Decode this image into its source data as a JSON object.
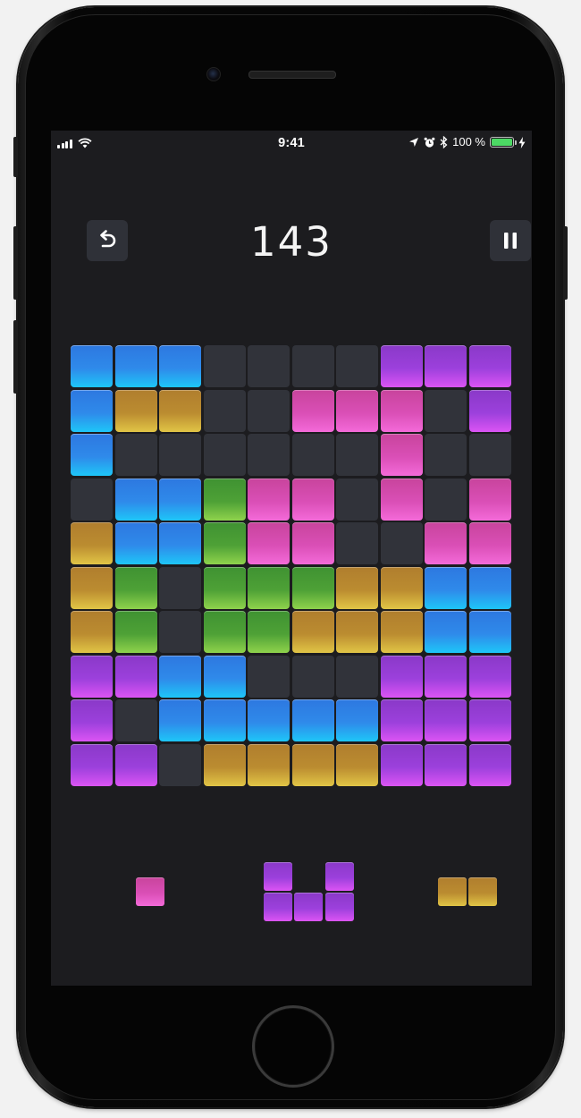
{
  "status_bar": {
    "time": "9:41",
    "battery_text": "100 %",
    "battery_level": 1.0,
    "icons": [
      "signal-bars-icon",
      "wifi-icon",
      "location-arrow-icon",
      "alarm-icon",
      "bluetooth-icon",
      "battery-icon",
      "charging-bolt-icon"
    ]
  },
  "game": {
    "score": "143",
    "undo_icon": "undo-icon",
    "pause_icon": "pause-icon",
    "colors": {
      "empty": "#31333a",
      "blue": "#2f8aea",
      "purple": "#9c40dc",
      "pink": "#da4fb6",
      "gold": "#bb8c30",
      "green": "#4ea136",
      "background": "#1c1c1f"
    },
    "board": [
      [
        "blue",
        "blue",
        "blue",
        "empty",
        "empty",
        "empty",
        "empty",
        "purple",
        "purple",
        "purple"
      ],
      [
        "blue",
        "gold",
        "gold",
        "empty",
        "empty",
        "pink",
        "pink",
        "pink",
        "empty",
        "purple"
      ],
      [
        "blue",
        "empty",
        "empty",
        "empty",
        "empty",
        "empty",
        "empty",
        "pink",
        "empty",
        "empty"
      ],
      [
        "empty",
        "blue",
        "blue",
        "green",
        "pink",
        "pink",
        "empty",
        "pink",
        "empty",
        "pink"
      ],
      [
        "gold",
        "blue",
        "blue",
        "green",
        "pink",
        "pink",
        "empty",
        "empty",
        "pink",
        "pink"
      ],
      [
        "gold",
        "green",
        "empty",
        "green",
        "green",
        "green",
        "gold",
        "gold",
        "blue",
        "blue"
      ],
      [
        "gold",
        "green",
        "empty",
        "green",
        "green",
        "gold",
        "gold",
        "gold",
        "blue",
        "blue"
      ],
      [
        "purple",
        "purple",
        "blue",
        "blue",
        "empty",
        "empty",
        "empty",
        "purple",
        "purple",
        "purple"
      ],
      [
        "purple",
        "empty",
        "blue",
        "blue",
        "blue",
        "blue",
        "blue",
        "purple",
        "purple",
        "purple"
      ],
      [
        "purple",
        "purple",
        "empty",
        "gold",
        "gold",
        "gold",
        "gold",
        "purple",
        "purple",
        "purple"
      ]
    ],
    "tray": [
      {
        "color": "pink",
        "shape": [
          [
            1
          ]
        ]
      },
      {
        "color": "purple",
        "shape": [
          [
            1,
            0,
            1
          ],
          [
            1,
            1,
            1
          ]
        ]
      },
      {
        "color": "gold",
        "shape": [
          [
            1,
            1
          ]
        ]
      }
    ]
  }
}
